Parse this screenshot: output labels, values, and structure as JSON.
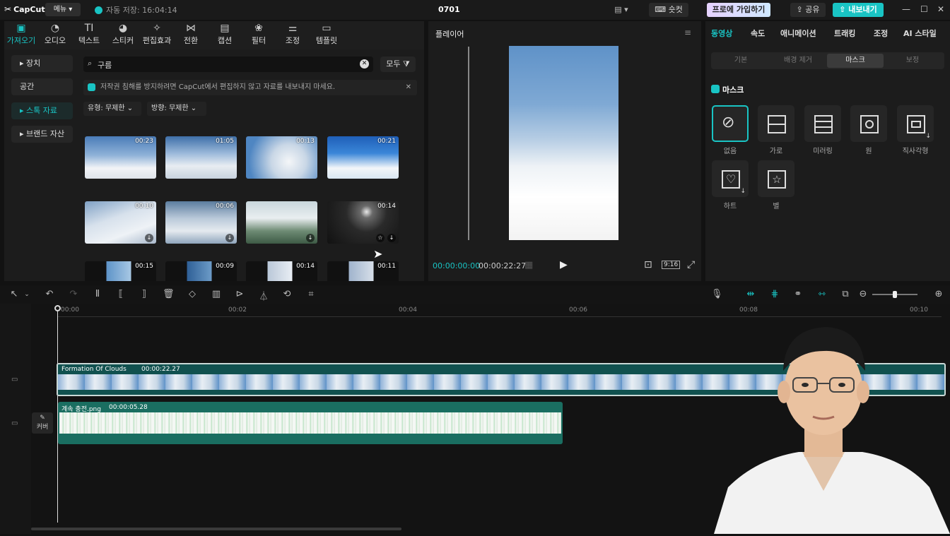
{
  "titlebar": {
    "logo": "CapCut",
    "menu": "메뉴",
    "autosave": "자동 저장: 16:04:14",
    "project": "0701",
    "shortcut": "숏컷",
    "pro": "프로에 가입하기",
    "share": "공유",
    "export": "내보내기"
  },
  "toolbar": {
    "items": [
      {
        "label": "가져오기",
        "icon": "import-icon"
      },
      {
        "label": "오디오",
        "icon": "audio-icon"
      },
      {
        "label": "텍스트",
        "icon": "text-icon"
      },
      {
        "label": "스티커",
        "icon": "sticker-icon"
      },
      {
        "label": "편집효과",
        "icon": "effects-icon"
      },
      {
        "label": "전환",
        "icon": "transition-icon"
      },
      {
        "label": "캡션",
        "icon": "caption-icon"
      },
      {
        "label": "필터",
        "icon": "filter-icon"
      },
      {
        "label": "조정",
        "icon": "adjust-icon"
      },
      {
        "label": "템플릿",
        "icon": "template-icon"
      }
    ]
  },
  "sidebar": {
    "items": [
      {
        "label": "장치"
      },
      {
        "label": "공간"
      },
      {
        "label": "스톡 자료"
      },
      {
        "label": "브랜드 자산"
      }
    ]
  },
  "media": {
    "search_value": "구름",
    "filter_all": "모두",
    "notice": "저작권 침해를 방지하려면 CapCut에서 편집하지 않고 자료를 내보내지 마세요.",
    "type_filter": "유형: 무제한",
    "dir_filter": "방향: 무제한",
    "durations": [
      "00:23",
      "01:05",
      "00:13",
      "00:21",
      "00:10",
      "00:06",
      "",
      "00:14",
      "00:15",
      "00:09",
      "00:14",
      "00:11"
    ]
  },
  "player": {
    "title": "플레이어",
    "current_time": "00:00:00:00",
    "total_time": "00:00:22:27",
    "ratio": "9:16"
  },
  "rpanel": {
    "tabs": [
      "동영상",
      "속도",
      "애니메이션",
      "트래킹",
      "조정",
      "AI 스타일"
    ],
    "subtabs": [
      "기본",
      "배경 제거",
      "마스크",
      "보정"
    ],
    "mask_section": "마스크",
    "masks": [
      "없음",
      "가로",
      "미러링",
      "원",
      "직사각형",
      "하트",
      "별"
    ]
  },
  "timeline": {
    "ruler": [
      "00:00",
      "00:02",
      "00:04",
      "00:06",
      "00:08",
      "00:10"
    ],
    "clip1_name": "Formation Of Clouds",
    "clip1_dur": "00:00:22.27",
    "clip2_name": "계속 충전.png",
    "clip2_dur": "00:00:05.28",
    "cover": "커버"
  },
  "colors": {
    "accent": "#19c4c4",
    "clip_video": "#11514f",
    "clip_audio": "#1a6e61"
  }
}
